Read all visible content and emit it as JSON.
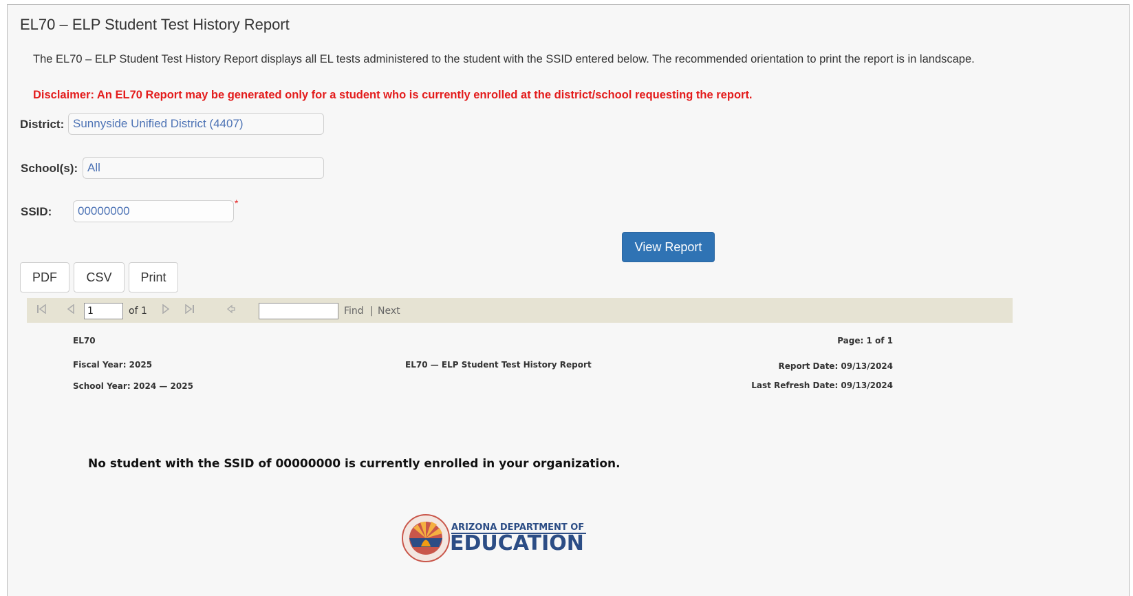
{
  "page": {
    "title": "EL70 – ELP Student Test History Report",
    "description": "The EL70 – ELP Student Test History Report displays all EL tests administered to the student with the SSID entered below. The recommended orientation to print the report is in landscape.",
    "disclaimer": "Disclaimer: An EL70 Report may be generated only for a student who is currently enrolled at the district/school requesting the report."
  },
  "form": {
    "district_label": "District:",
    "district_value": "Sunnyside Unified District (4407)",
    "schools_label": "School(s):",
    "schools_value": "All",
    "ssid_label": "SSID:",
    "ssid_value": "00000000",
    "required_marker": "*",
    "view_report_label": "View Report"
  },
  "export": {
    "pdf": "PDF",
    "csv": "CSV",
    "print": "Print"
  },
  "toolbar": {
    "page_value": "1",
    "of_pages": "of 1",
    "find_value": "",
    "find_label": "Find",
    "separator": "|",
    "next_label": "Next"
  },
  "report": {
    "code": "EL70",
    "page_info": "Page: 1 of 1",
    "fiscal_year": "Fiscal Year: 2025",
    "report_title": "EL70 — ELP Student Test History Report",
    "report_date": "Report Date: 09/13/2024",
    "school_year": "School Year: 2024 — 2025",
    "refresh_date": "Last Refresh Date: 09/13/2024",
    "message": "No student with the SSID of 00000000 is currently enrolled in your organization."
  },
  "logo": {
    "line1": "ARIZONA DEPARTMENT OF",
    "line2": "EDUCATION"
  },
  "colors": {
    "primary_button": "#2f73b4",
    "disclaimer": "#e31b1b",
    "toolbar_bg": "#e6e3d3",
    "logo_blue": "#2c4d85"
  }
}
